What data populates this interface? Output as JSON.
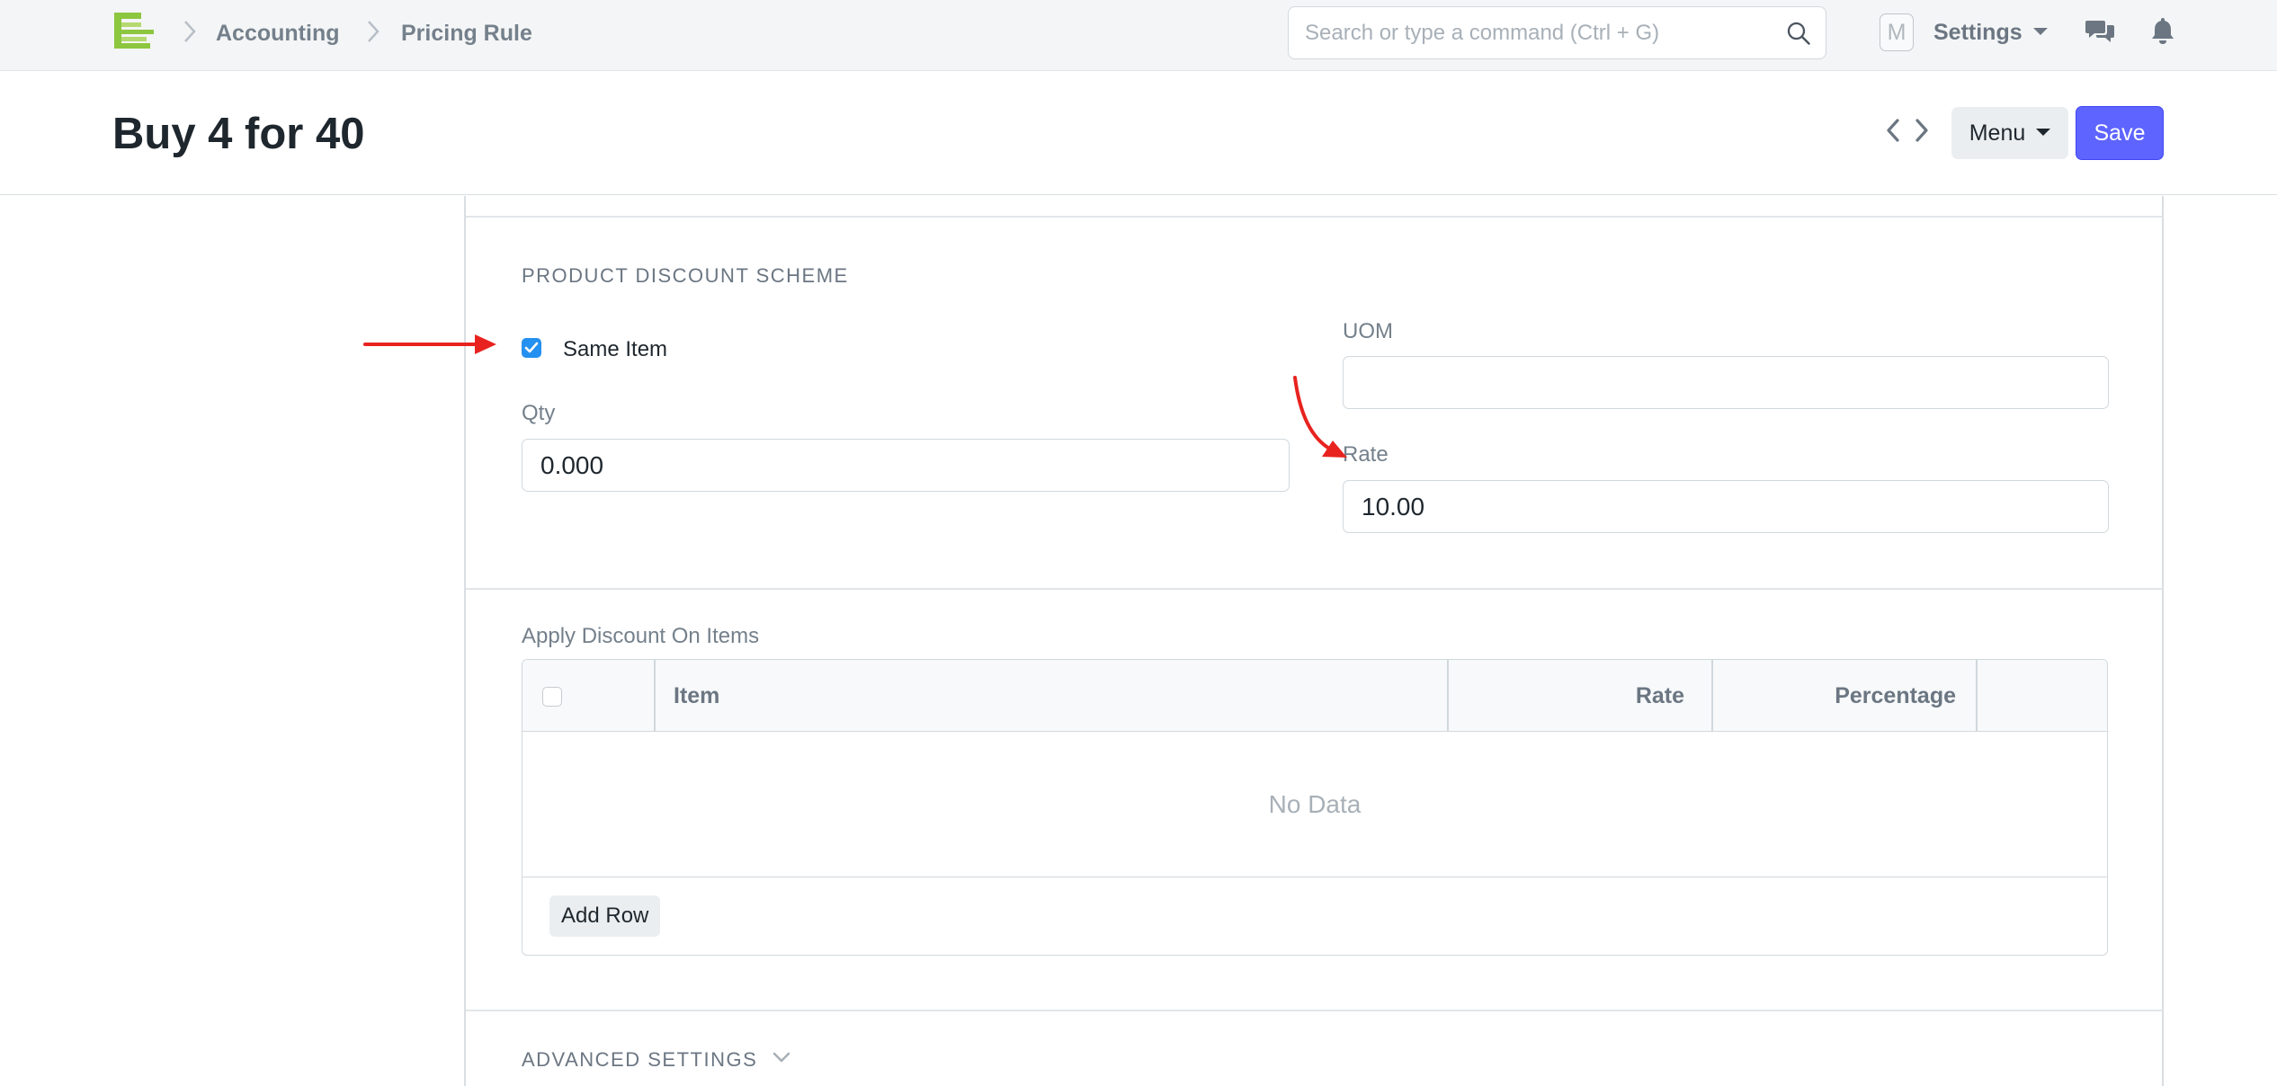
{
  "navbar": {
    "breadcrumbs": [
      "Accounting",
      "Pricing Rule"
    ],
    "search_placeholder": "Search or type a command (Ctrl + G)",
    "avatar_initial": "M",
    "settings_label": "Settings"
  },
  "page": {
    "title": "Buy 4 for 40",
    "menu_label": "Menu",
    "save_label": "Save"
  },
  "product_discount": {
    "section_title": "PRODUCT DISCOUNT SCHEME",
    "same_item_label": "Same Item",
    "same_item_checked": true,
    "qty_label": "Qty",
    "qty_value": "0.000",
    "uom_label": "UOM",
    "uom_value": "",
    "rate_label": "Rate",
    "rate_value": "10.00"
  },
  "apply_discount_table": {
    "label": "Apply Discount On Items",
    "columns": [
      "Item",
      "Rate",
      "Percentage"
    ],
    "rows": [],
    "empty_text": "No Data",
    "add_row_label": "Add Row"
  },
  "advanced_settings": {
    "title": "ADVANCED SETTINGS"
  },
  "colors": {
    "primary": "#5e64ff",
    "checkbox": "#2490ef",
    "annotation_arrow": "#e8231f",
    "logo_green": "#8dc63f"
  }
}
